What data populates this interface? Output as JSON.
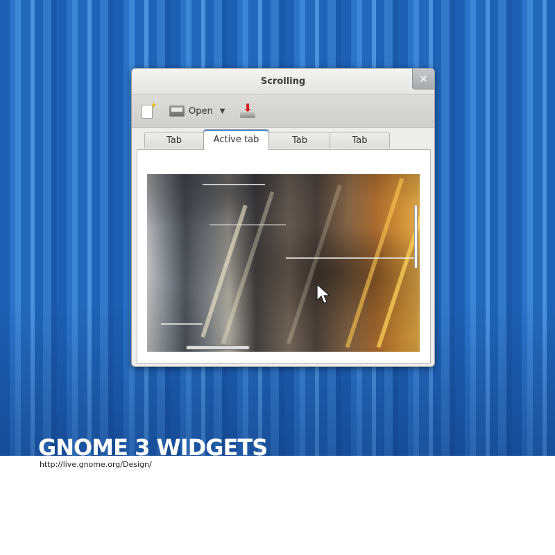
{
  "window": {
    "title": "Scrolling",
    "close_glyph": "✕"
  },
  "toolbar": {
    "new_icon": "new-document-icon",
    "open_label": "Open",
    "open_chevron": "⌄",
    "save_icon": "download-save-icon"
  },
  "tabs": [
    {
      "label": "Tab",
      "active": false
    },
    {
      "label": "Active tab",
      "active": true
    },
    {
      "label": "Tab",
      "active": false
    },
    {
      "label": "Tab",
      "active": false
    }
  ],
  "content": {
    "image": "abstract-skull-artwork",
    "vertical_scroll_position": 0.2,
    "horizontal_scroll_position": 0.15
  },
  "footer": {
    "title": "GNOME 3 WIDGETS",
    "url": "http://live.gnome.org/Design/"
  },
  "colors": {
    "desktop_blue": "#1d5fb3",
    "active_tab_accent": "#4a90d9",
    "window_bg": "#ededec"
  }
}
